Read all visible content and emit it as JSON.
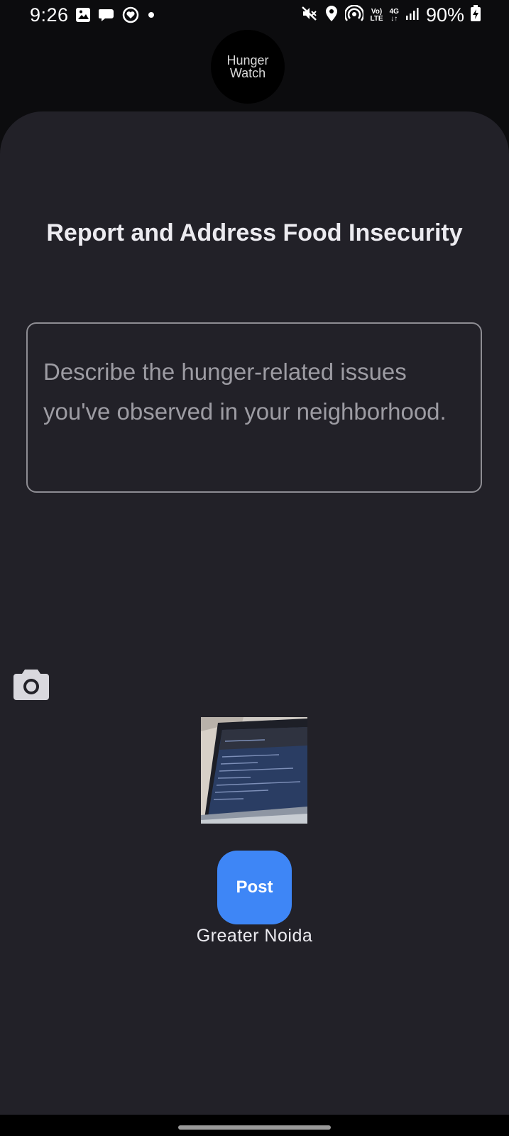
{
  "status_bar": {
    "time": "9:26",
    "battery": "90%",
    "network_label_top": "Vo)",
    "network_label_bottom": "LTE",
    "network_type": "4G",
    "left_icons": [
      "image-icon",
      "chat-icon",
      "heart-badge-icon",
      "dot-icon"
    ],
    "right_icons": [
      "mute-icon",
      "location-pin-icon",
      "hotspot-icon",
      "signal-icon",
      "battery-charging-icon"
    ]
  },
  "app": {
    "logo_line1": "Hunger",
    "logo_line2": "Watch"
  },
  "main": {
    "title": "Report and Address Food Insecurity",
    "description_placeholder": "Describe the hunger-related issues you've observed in your neighborhood.",
    "camera_icon": "camera-icon",
    "post_label": "Post",
    "location": "Greater Noida"
  },
  "colors": {
    "background": "#0c0c0e",
    "sheet": "#222128",
    "accent": "#3e86f6",
    "text": "#ecebf0",
    "placeholder": "#9d9ca3"
  }
}
